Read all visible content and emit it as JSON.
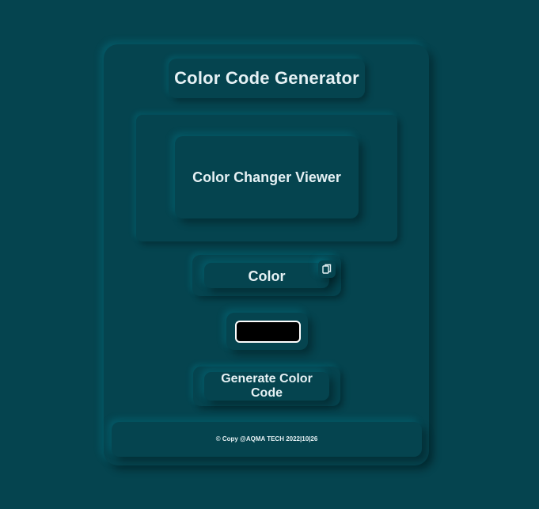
{
  "header": {
    "title": "Color Code Generator"
  },
  "viewer": {
    "label": "Color Changer Viewer"
  },
  "color_output": {
    "value": "Color",
    "copy_icon": "copy-icon"
  },
  "color_picker": {
    "value": "#000000"
  },
  "generate_button": {
    "label": "Generate Color Code"
  },
  "footer": {
    "text": "© Copy @AQMA TECH 2022|10|26"
  },
  "colors": {
    "background": "#05444f",
    "text": "#e6f1f4",
    "swatch": "#000000"
  }
}
